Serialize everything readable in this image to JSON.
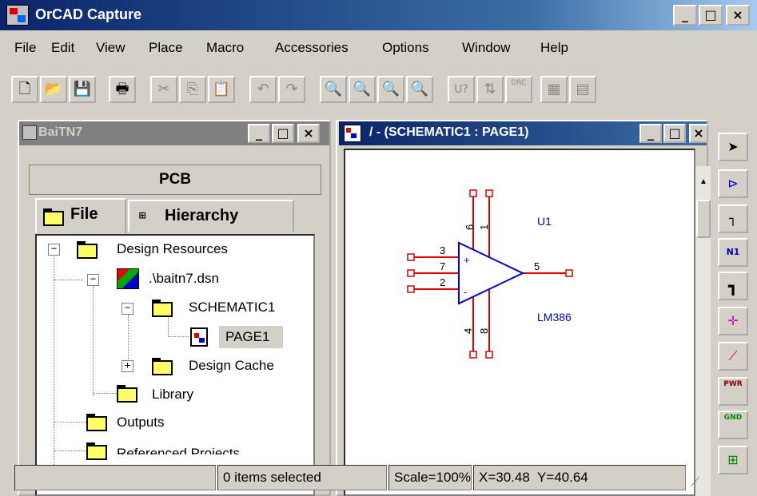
{
  "app": {
    "title": "OrCAD Capture",
    "caption_buttons": {
      "minimize": "_",
      "maximize": "□",
      "close": "×"
    }
  },
  "menu": [
    "File",
    "Edit",
    "View",
    "Place",
    "Macro",
    "Accessories",
    "Options",
    "Window",
    "Help"
  ],
  "toolbar": {
    "buttons": [
      "new-icon",
      "open-icon",
      "save-icon",
      "print-icon",
      "cut-icon",
      "copy-icon",
      "paste-icon",
      "undo-icon",
      "redo-icon",
      "zoom-in-icon",
      "zoom-out-icon",
      "zoom-area-icon",
      "zoom-all-icon",
      "annotate-icon",
      "back-annotate-icon",
      "drc-icon",
      "netlist-icon",
      "bom-icon"
    ],
    "labels": {
      "annotate": "U?",
      "drc": "DRC"
    }
  },
  "project_window": {
    "title": "BaiTN7",
    "header": "PCB",
    "tabs": [
      "File",
      "Hierarchy"
    ],
    "tree": {
      "design_resources": "Design Resources",
      "dsn_file": ".\\baitn7.dsn",
      "schematic": "SCHEMATIC1",
      "page": "PAGE1",
      "design_cache": "Design Cache",
      "library": "Library",
      "outputs": "Outputs",
      "referenced_projects": "Referenced Projects"
    }
  },
  "schematic_window": {
    "title": "/ - (SCHEMATIC1 : PAGE1)",
    "part": {
      "refdes": "U1",
      "value": "LM386",
      "pins": {
        "in_plus": "3",
        "in_minus": "2",
        "pin7": "7",
        "output": "5",
        "vs": "6",
        "pin1": "1",
        "gnd": "4",
        "pin8": "8"
      },
      "plus_sign": "+",
      "minus_sign": "-"
    }
  },
  "palette": {
    "items": [
      "select-icon",
      "place-part-icon",
      "place-wire-icon",
      "net-alias-icon",
      "place-bus-icon",
      "junction-icon",
      "bus-entry-icon",
      "power-icon",
      "ground-icon",
      "off-page-connector-icon"
    ],
    "labels": {
      "net_alias": "N1",
      "power": "PWR",
      "ground": "GND"
    }
  },
  "statusbar": {
    "selection": "0 items selected",
    "scale": "Scale=100%",
    "coords": "X=30.48  Y=40.64"
  },
  "colors": {
    "active_title": "#0a246a",
    "inactive_title": "#808080",
    "wire_red": "#d00000",
    "part_blue": "#0000c0",
    "folder_yellow": "#ffff66"
  }
}
